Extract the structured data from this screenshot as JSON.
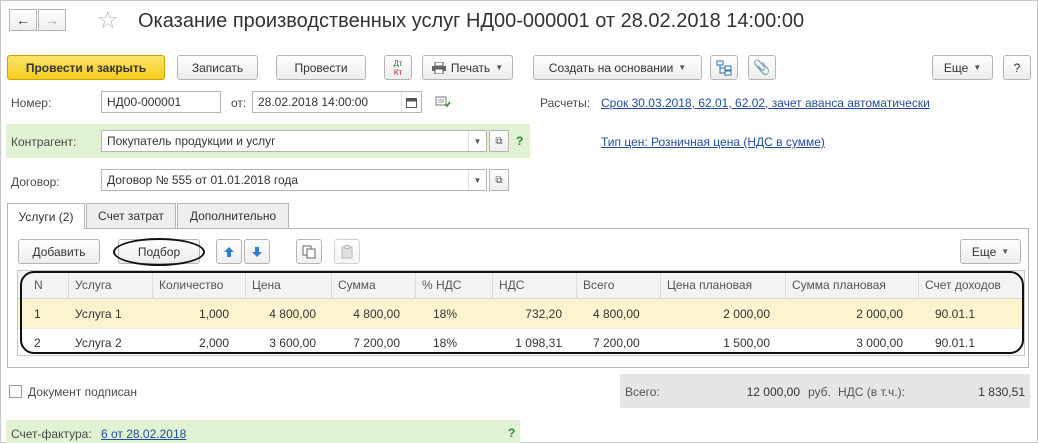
{
  "header": {
    "back_icon": "arrow-left-icon",
    "forward_icon": "arrow-right-icon",
    "favorite_icon": "star-icon",
    "title": "Оказание производственных услуг НД00-000001 от 28.02.2018 14:00:00"
  },
  "toolbar": {
    "post_close": "Провести и закрыть",
    "save": "Записать",
    "post": "Провести",
    "dt_kt": "Дт",
    "dt_kt2": "Кт",
    "print": "Печать",
    "create_based": "Создать на основании",
    "more": "Еще",
    "help": "?"
  },
  "fields": {
    "number_label": "Номер:",
    "number_value": "НД00-000001",
    "from_label": "от:",
    "date_value": "28.02.2018 14:00:00",
    "payments_label": "Расчеты:",
    "payments_link": "Срок 30.03.2018, 62.01, 62.02, зачет аванса автоматически",
    "counterparty_label": "Контрагент:",
    "counterparty_value": "Покупатель продукции и услуг",
    "price_type_link": "Тип цен: Розничная цена (НДС в сумме)",
    "contract_label": "Договор:",
    "contract_value": "Договор № 555 от 01.01.2018 года",
    "help_mark": "?"
  },
  "tabs": [
    {
      "label": "Услуги (2)"
    },
    {
      "label": "Счет затрат"
    },
    {
      "label": "Дополнительно"
    }
  ],
  "table_toolbar": {
    "add": "Добавить",
    "pick": "Подбор",
    "more": "Еще"
  },
  "table": {
    "headers": [
      "N",
      "Услуга",
      "Количество",
      "Цена",
      "Сумма",
      "% НДС",
      "НДС",
      "Всего",
      "Цена плановая",
      "Сумма плановая",
      "Счет доходов"
    ],
    "rows": [
      [
        "1",
        "Услуга 1",
        "1,000",
        "4 800,00",
        "4 800,00",
        "18%",
        "732,20",
        "4 800,00",
        "2 000,00",
        "2 000,00",
        "90.01.1"
      ],
      [
        "2",
        "Услуга 2",
        "2,000",
        "3 600,00",
        "7 200,00",
        "18%",
        "1 098,31",
        "7 200,00",
        "1 500,00",
        "3 000,00",
        "90.01.1"
      ]
    ]
  },
  "footer": {
    "signed_label": "Документ подписан",
    "total_label": "Всего:",
    "total_value": "12 000,00",
    "currency": "руб.",
    "vat_label": "НДС (в т.ч.):",
    "vat_value": "1 830,51",
    "invoice_label": "Счет-фактура:",
    "invoice_link": "6  от 28.02.2018",
    "help_mark": "?"
  },
  "colors": {
    "primary_button": "#f3cc1d",
    "green_highlight": "#e1f1d3",
    "link": "#1f4e9e",
    "selected_row": "#fbf4cf",
    "arrow_blue": "#2f7fd3"
  }
}
